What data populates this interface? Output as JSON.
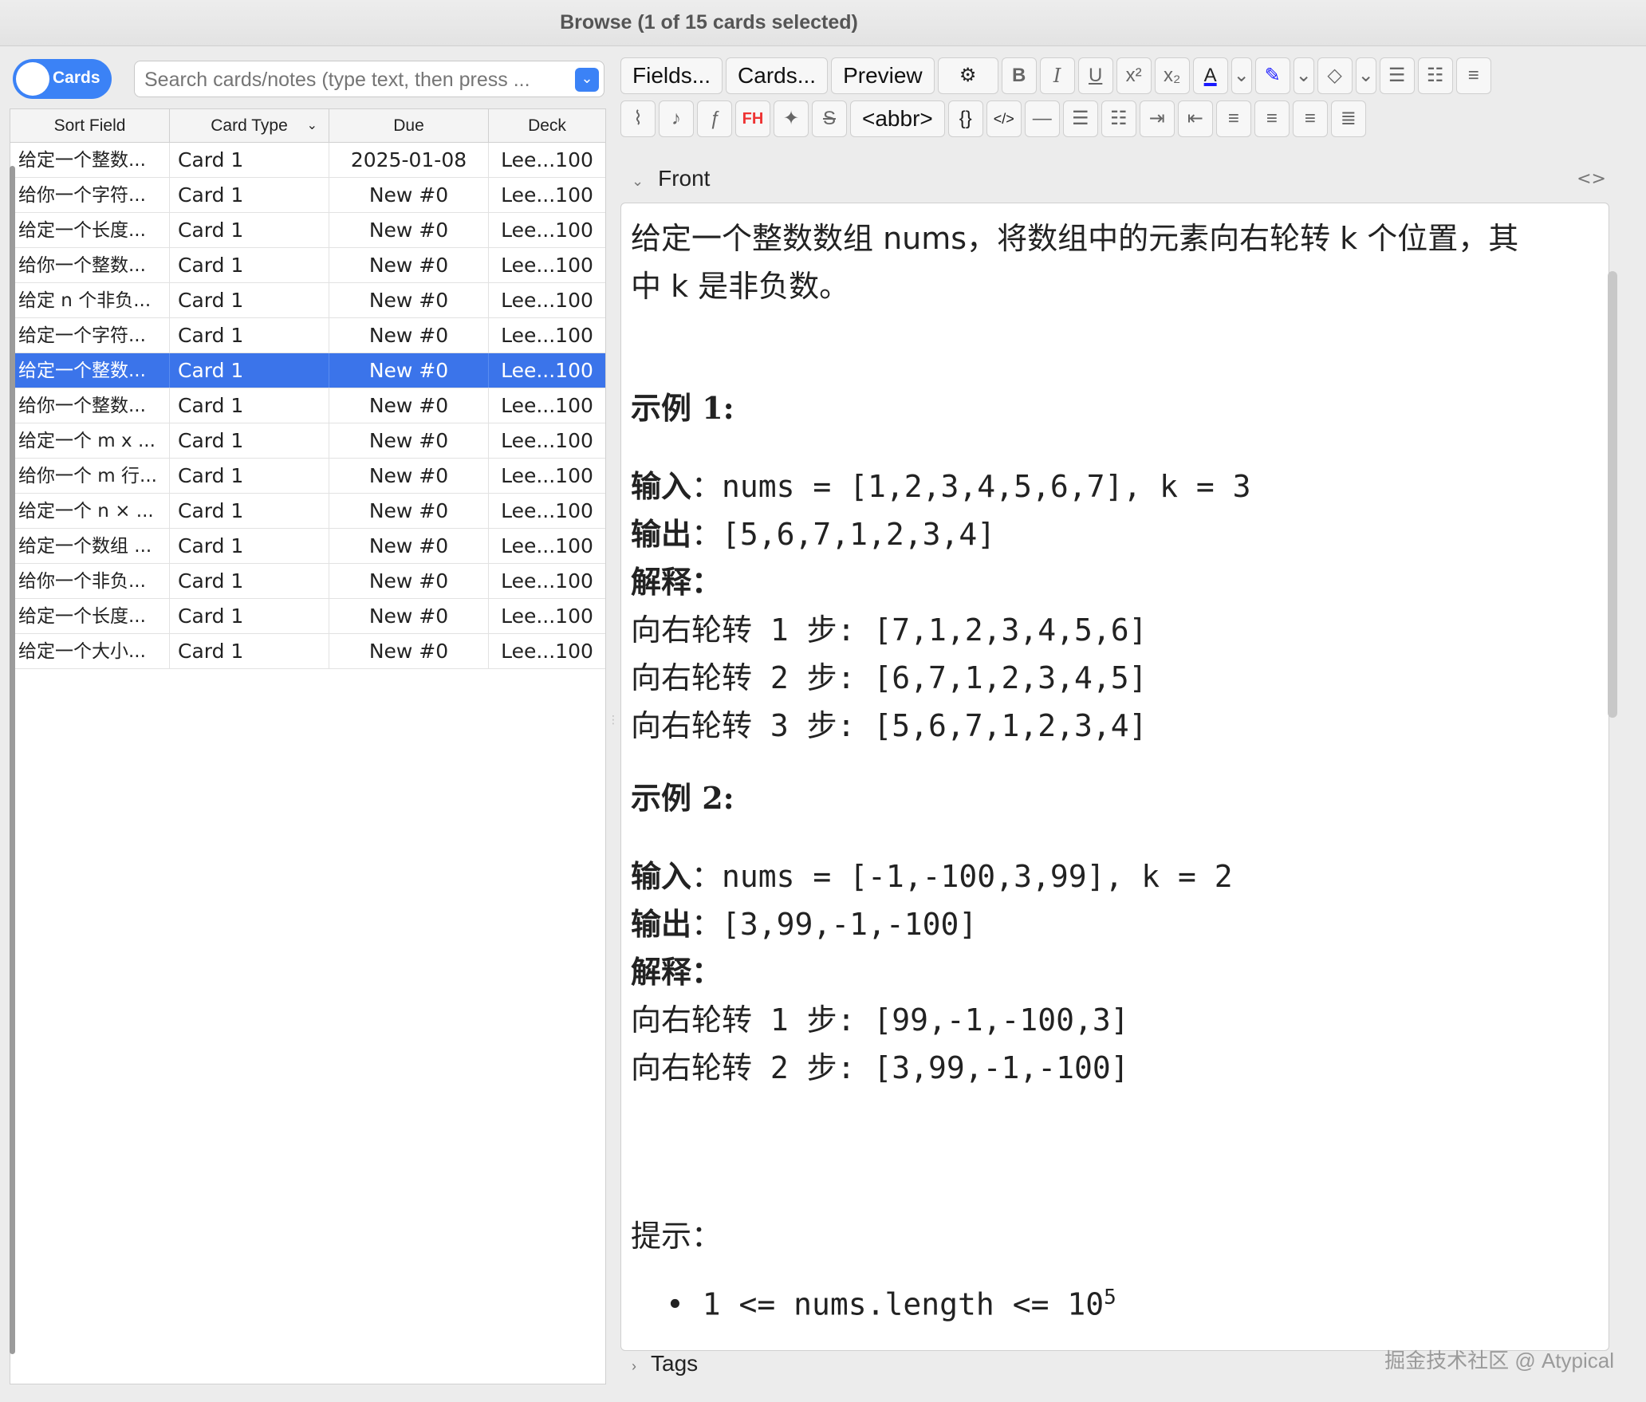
{
  "window": {
    "title": "Browse (1 of 15 cards selected)"
  },
  "left": {
    "toggle_label": "Cards",
    "search_placeholder": "Search cards/notes (type text, then press ...",
    "columns": [
      "Sort Field",
      "Card Type",
      "Due",
      "Deck"
    ],
    "rows": [
      {
        "sort": "给定一个整数...",
        "type": "Card 1",
        "due": "2025-01-08",
        "deck": "Lee...100",
        "selected": false
      },
      {
        "sort": "给你一个字符...",
        "type": "Card 1",
        "due": "New #0",
        "deck": "Lee...100",
        "selected": false
      },
      {
        "sort": "给定一个长度...",
        "type": "Card 1",
        "due": "New #0",
        "deck": "Lee...100",
        "selected": false
      },
      {
        "sort": "给你一个整数...",
        "type": "Card 1",
        "due": "New #0",
        "deck": "Lee...100",
        "selected": false
      },
      {
        "sort": "给定 n 个非负...",
        "type": "Card 1",
        "due": "New #0",
        "deck": "Lee...100",
        "selected": false
      },
      {
        "sort": "给定一个字符...",
        "type": "Card 1",
        "due": "New #0",
        "deck": "Lee...100",
        "selected": false
      },
      {
        "sort": "给定一个整数...",
        "type": "Card 1",
        "due": "New #0",
        "deck": "Lee...100",
        "selected": true
      },
      {
        "sort": "给你一个整数...",
        "type": "Card 1",
        "due": "New #0",
        "deck": "Lee...100",
        "selected": false
      },
      {
        "sort": "给定一个 m x ...",
        "type": "Card 1",
        "due": "New #0",
        "deck": "Lee...100",
        "selected": false
      },
      {
        "sort": "给你一个 m 行...",
        "type": "Card 1",
        "due": "New #0",
        "deck": "Lee...100",
        "selected": false
      },
      {
        "sort": "给定一个 n × ...",
        "type": "Card 1",
        "due": "New #0",
        "deck": "Lee...100",
        "selected": false
      },
      {
        "sort": "给定一个数组 ...",
        "type": "Card 1",
        "due": "New #0",
        "deck": "Lee...100",
        "selected": false
      },
      {
        "sort": "给你一个非负...",
        "type": "Card 1",
        "due": "New #0",
        "deck": "Lee...100",
        "selected": false
      },
      {
        "sort": "给定一个长度...",
        "type": "Card 1",
        "due": "New #0",
        "deck": "Lee...100",
        "selected": false
      },
      {
        "sort": "给定一个大小...",
        "type": "Card 1",
        "due": "New #0",
        "deck": "Lee...100",
        "selected": false
      }
    ]
  },
  "toolbar": {
    "fields": "Fields...",
    "cards": "Cards...",
    "preview": "Preview",
    "bold": "B",
    "italic": "I",
    "underline": "U",
    "superscript": "x²",
    "subscript": "x₂",
    "fh": "FH",
    "abbr": "<abbr>",
    "braces": "{}",
    "code": "</>"
  },
  "editor": {
    "field_name": "Front",
    "intro_line1": "给定一个整数数组 nums，将数组中的元素向右轮转 k 个位置，其",
    "intro_line2": "中 k 是非负数。",
    "ex1_title": "示例 1:",
    "ex1_input_label": "输入",
    "ex1_input": "：nums = [1,2,3,4,5,6,7], k = 3",
    "ex1_output_label": "输出",
    "ex1_output": "：[5,6,7,1,2,3,4]",
    "ex1_explain": "解释：",
    "ex1_step1": "向右轮转 1 步: [7,1,2,3,4,5,6]",
    "ex1_step2": "向右轮转 2 步: [6,7,1,2,3,4,5]",
    "ex1_step3": "向右轮转 3 步: [5,6,7,1,2,3,4]",
    "ex2_title": "示例 2:",
    "ex2_input_label": "输入",
    "ex2_input": "：nums = [-1,-100,3,99], k = 2",
    "ex2_output_label": "输出",
    "ex2_output": "：[3,99,-1,-100]",
    "ex2_explain": "解释：",
    "ex2_step1": "向右轮转 1 步: [99,-1,-100,3]",
    "ex2_step2": "向右轮转 2 步: [3,99,-1,-100]",
    "hint_title": "提示：",
    "hint_1": "1 <= nums.length <= 10",
    "hint_1_sup": "5"
  },
  "tags_label": "Tags",
  "watermark": "掘金技术社区 @ Atypical"
}
